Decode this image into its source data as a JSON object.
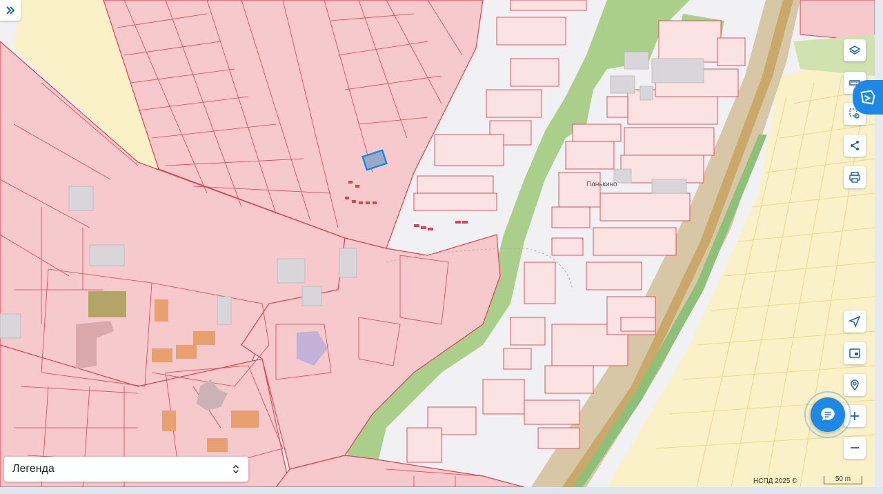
{
  "map": {
    "place_label": "Панькино",
    "attribution": "НСПД 2025 ©",
    "scale_label": "50 m"
  },
  "controls": {
    "expand_icon": "double-chevron-right-icon",
    "right_toolbar": [
      "layers-icon",
      "ruler-icon",
      "select-area-icon",
      "share-icon",
      "print-icon"
    ],
    "bottom_toolbar": [
      "locate-icon",
      "minimap-icon",
      "search-point-icon",
      "zoom-in-icon",
      "zoom-out-icon"
    ],
    "chat_icon": "chat-icon",
    "side_badge_icon": "service-logo-icon"
  },
  "legend": {
    "label": "Легенда"
  },
  "colors": {
    "parcel_fill": "#f6c9cc",
    "parcel_stroke": "#e0404f",
    "river_green": "#a9cf8a",
    "railway": "#d8c39b",
    "yellow_zone": "#faf1c8",
    "accent": "#1e88e5"
  }
}
